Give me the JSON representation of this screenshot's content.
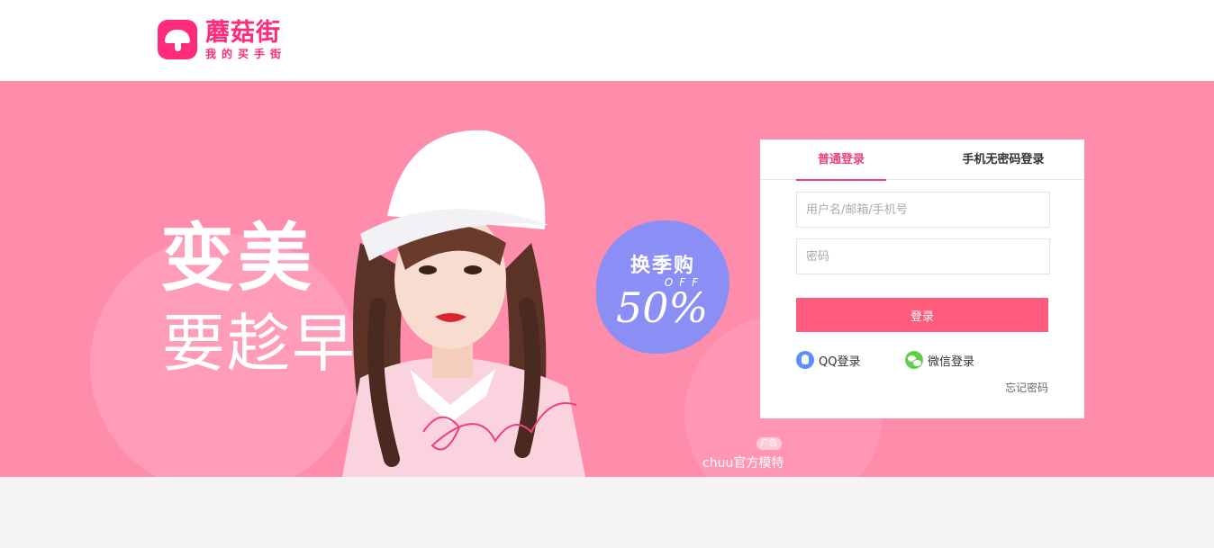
{
  "header": {
    "logo_name": "蘑菇街",
    "logo_slogan": "我的买手街"
  },
  "banner": {
    "headline": "变美",
    "subline": "要趁早",
    "promo_title": "换季购",
    "promo_off": "OFF",
    "promo_percent": "50%",
    "script_text": "Girl",
    "ad_badge": "广告",
    "model_credit": "chuu官方模特"
  },
  "login": {
    "tabs": [
      {
        "label": "普通登录",
        "active": true
      },
      {
        "label": "手机无密码登录",
        "active": false
      }
    ],
    "username_placeholder": "用户名/邮箱/手机号",
    "password_placeholder": "密码",
    "submit_label": "登录",
    "qq_label": "QQ登录",
    "wechat_label": "微信登录",
    "forgot_label": "忘记密码"
  },
  "colors": {
    "brand": "#ff2a7a",
    "banner_bg": "#fe8cab",
    "button": "#ff5b7c",
    "active_tab": "#f0407a",
    "promo_badge": "#8b8ef5"
  }
}
